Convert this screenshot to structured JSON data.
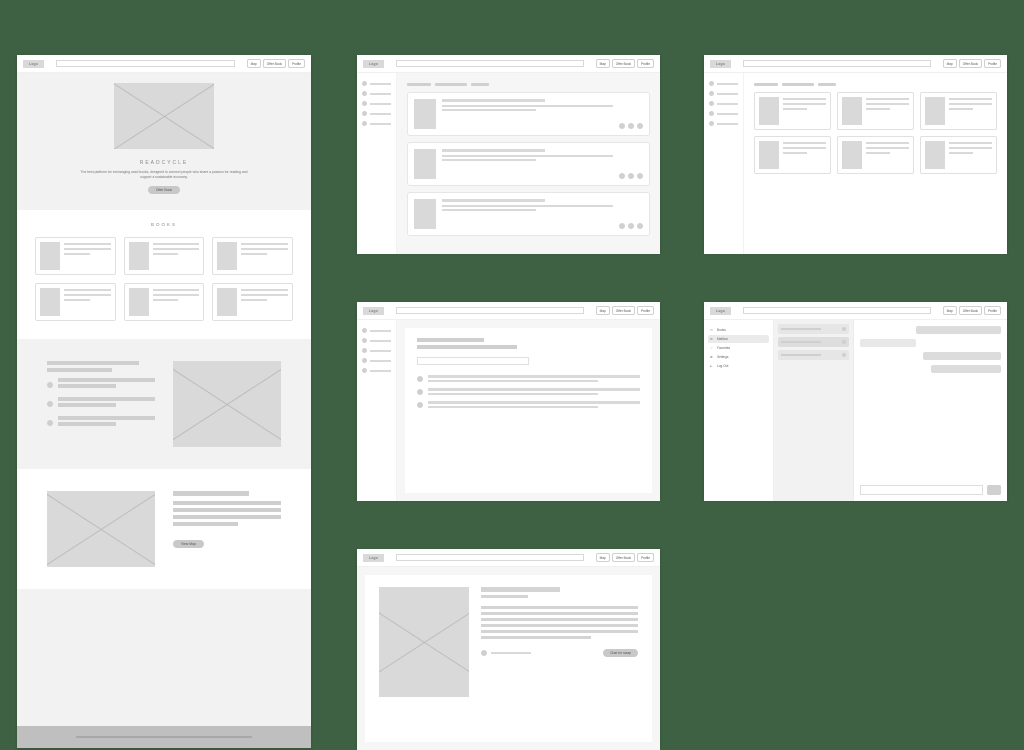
{
  "nav": {
    "logo": "Logo",
    "map": "Map",
    "offer": "Offer Book",
    "profile": "Profile"
  },
  "landing": {
    "brand": "READCYCLE",
    "tagline": "The best platform for exchanging used books, designed to connect people who share a passion for reading and support a sustainable economy.",
    "cta": "Offer Book",
    "books_heading": "BOOKS",
    "promo_cta": "View Map"
  },
  "mailbox": {
    "items": [
      {
        "label": "Books"
      },
      {
        "label": "Mailbox"
      },
      {
        "label": "Favorites"
      },
      {
        "label": "Settings"
      },
      {
        "label": "Log Out"
      }
    ]
  },
  "detail": {
    "swap": "Chat for swap"
  }
}
